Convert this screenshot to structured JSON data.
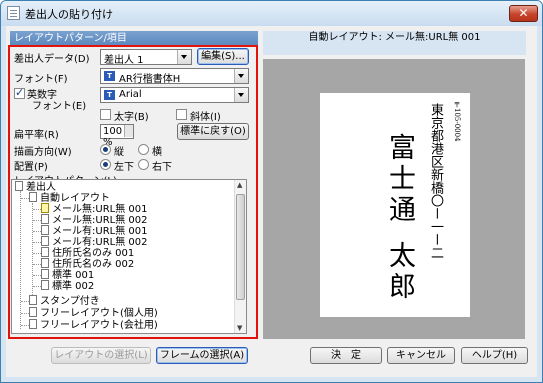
{
  "window": {
    "title": "差出人の貼り付け",
    "close_symbol": "✕"
  },
  "left_panel": {
    "header": "レイアウトパターン/項目",
    "sender_data_label": "差出人データ(D)",
    "sender_data_value": "差出人 1",
    "edit_button": "編集(S)...",
    "font_label": "フォント(F)",
    "font_value": "AR行楷書体H",
    "alnum_label_1": "英数字",
    "alnum_label_2": "フォント(E)",
    "alnum_font_value": "Arial",
    "bold_label": "太字(B)",
    "italic_label": "斜体(I)",
    "flatness_label": "扁平率(R)",
    "flatness_value": "100 %",
    "reset_button": "標準に戻す(O)",
    "direction_label": "描画方向(W)",
    "direction_vertical": "縦",
    "direction_horizontal": "横",
    "align_label": "配置(P)",
    "align_left_bottom": "左下",
    "align_right_bottom": "右下",
    "pattern_label": "レイアウトパターン(L)",
    "tt_icon_text": "T"
  },
  "tree": {
    "items": [
      {
        "label": "差出人"
      },
      {
        "label": "自動レイアウト"
      },
      {
        "label": "メール無:URL無 001"
      },
      {
        "label": "メール無:URL無 002"
      },
      {
        "label": "メール有:URL無 001"
      },
      {
        "label": "メール有:URL無 002"
      },
      {
        "label": "住所氏名のみ 001"
      },
      {
        "label": "住所氏名のみ 002"
      },
      {
        "label": "標準 001"
      },
      {
        "label": "標準 002"
      },
      {
        "label": "スタンプ付き"
      },
      {
        "label": "フリーレイアウト(個人用)"
      },
      {
        "label": "フリーレイアウト(会社用)"
      }
    ],
    "selected_index": 2
  },
  "right_panel": {
    "title": "自動レイアウト: メール無:URL無 001"
  },
  "preview": {
    "postal": "〒105-0004",
    "address": "東京都港区新橋〇ー一ー二",
    "company": "富士通",
    "name": "太郎"
  },
  "buttons": {
    "select_layout": "レイアウトの選択(L)",
    "select_frame": "フレームの選択(A)",
    "ok": "決　定",
    "cancel": "キャンセル",
    "help": "ヘルプ(H)"
  },
  "colors": {
    "highlight_frame": "#e3120b",
    "header_blue": "#5b87bd"
  }
}
